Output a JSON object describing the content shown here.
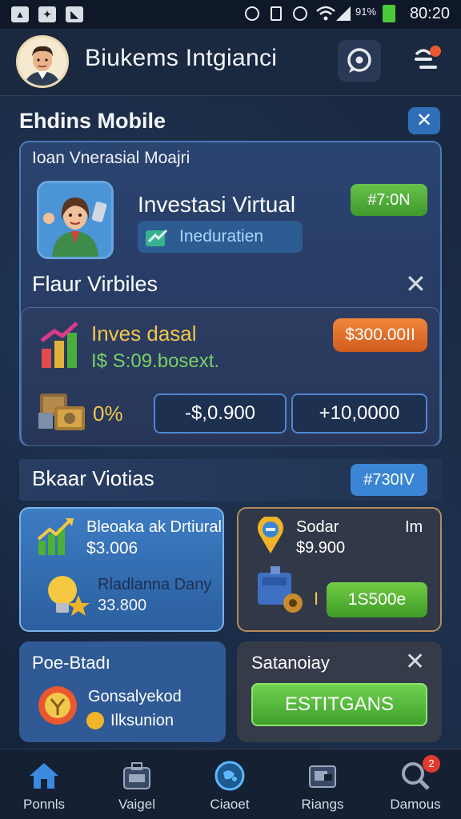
{
  "status_bar": {
    "percent": "91%",
    "time": "80:20"
  },
  "header": {
    "title": "Biukems Intgianci"
  },
  "section1": {
    "title": "Ehdins  Mobile",
    "panel_subtitle": "Ioan Vnerasial Moajri",
    "invest_title": "Investasi Virtual",
    "invest_price": "#7:0N",
    "tag_label": "Ineduratien",
    "sub_title": "Flaur Virbiles",
    "card": {
      "line1": "Inves dasal",
      "line2": "I$ S:09.bosext.",
      "price": "$300.00II",
      "percent": "0%",
      "amount_minus": "-$,0.900",
      "amount_plus": "+10,0000"
    }
  },
  "section2": {
    "title": "Bkaar Viotias",
    "price": "#730IV",
    "card_a": {
      "title": "Bleoaka ak Drtiural",
      "value": "$3.006",
      "sub_title": "Rladlanna Dany",
      "sub_value": "33.800"
    },
    "card_b": {
      "title": "Sodar",
      "right_label": "Im",
      "value": "$9.900",
      "cta": "1S500e",
      "sep": "I"
    },
    "card_c": {
      "title": "Poe-Btadı",
      "line1": "Gonsalyekod",
      "line2": "Ilksunion"
    },
    "card_d": {
      "title": "Satanoiay",
      "cta": "ESTITGANS"
    }
  },
  "bottom_nav": {
    "items": [
      {
        "label": "Ponnls",
        "icon": "home-icon"
      },
      {
        "label": "Vaigel",
        "icon": "briefcase-icon"
      },
      {
        "label": "Ciaoet",
        "icon": "globe-icon"
      },
      {
        "label": "Riangs",
        "icon": "wallet-icon"
      },
      {
        "label": "Damous",
        "icon": "search-icon"
      }
    ],
    "badge": "2"
  },
  "colors": {
    "background": "#16233a",
    "green": "#4caf36",
    "orange": "#e0702c",
    "blue": "#3a86d4",
    "gold": "#f0c84b"
  }
}
